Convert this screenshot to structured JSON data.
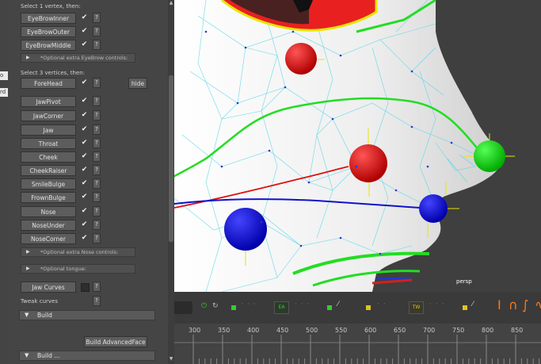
{
  "panel": {
    "label_one_vertex": "Select 1 vertex, then:",
    "eyebrow_buttons": [
      "EyeBrowInner",
      "EyeBrowOuter",
      "EyeBrowMiddle"
    ],
    "opt_eyebrow": "*Optional extra EyeBrow controls:",
    "label_three_vertices": "Select 3 vertices, then:",
    "forehead": "ForeHead",
    "hide": "hide",
    "controls": [
      "JawPivot",
      "JawCorner",
      "Jaw",
      "Throat",
      "Cheek",
      "CheekRaiser",
      "SmileBulge",
      "FrownBulge",
      "Nose",
      "NoseUnder",
      "NoseCorner"
    ],
    "opt_nose": "*Optional extra Nose controls:",
    "opt_tongue": "*Optional tongue:",
    "jaw_curves": "Jaw Curves",
    "tweak_curves": "Tweak curves",
    "build": "Build",
    "build_advanced": "Build AdvancedFace",
    "build_more": "Build ...",
    "check_mark": "✔",
    "question": "?"
  },
  "left_strip": [
    "o",
    "rd"
  ],
  "viewport": {
    "camera": "persp"
  },
  "shelf": {
    "ea": "EA",
    "tw": "TW"
  },
  "timeline": {
    "ticks": [
      "300",
      "350",
      "400",
      "450",
      "500",
      "550",
      "600",
      "650",
      "700",
      "750",
      "800",
      "850"
    ]
  },
  "colors": {
    "curve_green": "#22dd22",
    "curve_red": "#dd1111",
    "curve_blue": "#1111cc",
    "wire": "#4fd4e8"
  }
}
